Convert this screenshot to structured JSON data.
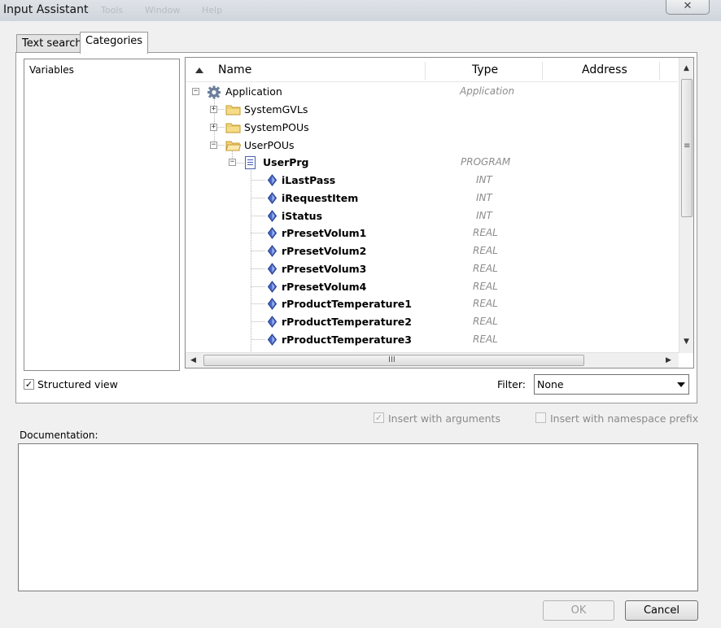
{
  "window": {
    "title": "Input Assistant",
    "background_menu": [
      "Tools",
      "Window",
      "Help"
    ]
  },
  "tabs": [
    {
      "label": "Text search",
      "active": false
    },
    {
      "label": "Categories",
      "active": true
    }
  ],
  "categories": [
    "Variables"
  ],
  "table": {
    "columns": [
      "Name",
      "Type",
      "Address"
    ],
    "rows": [
      {
        "name": "Application",
        "type": "Application",
        "bold": false,
        "expander": "minus",
        "icon": "gear-icon"
      },
      {
        "name": "SystemGVLs",
        "type": "",
        "bold": false,
        "expander": "plus",
        "icon": "folder-icon"
      },
      {
        "name": "SystemPOUs",
        "type": "",
        "bold": false,
        "expander": "plus",
        "icon": "folder-icon"
      },
      {
        "name": "UserPOUs",
        "type": "",
        "bold": false,
        "expander": "minus",
        "icon": "folder-open-icon"
      },
      {
        "name": "UserPrg",
        "type": "PROGRAM",
        "bold": true,
        "expander": "minus",
        "icon": "program-icon"
      },
      {
        "name": "iLastPass",
        "type": "INT",
        "bold": true,
        "icon": "variable-icon"
      },
      {
        "name": "iRequestItem",
        "type": "INT",
        "bold": true,
        "icon": "variable-icon"
      },
      {
        "name": "iStatus",
        "type": "INT",
        "bold": true,
        "icon": "variable-icon"
      },
      {
        "name": "rPresetVolum1",
        "type": "REAL",
        "bold": true,
        "icon": "variable-icon"
      },
      {
        "name": "rPresetVolum2",
        "type": "REAL",
        "bold": true,
        "icon": "variable-icon"
      },
      {
        "name": "rPresetVolum3",
        "type": "REAL",
        "bold": true,
        "icon": "variable-icon"
      },
      {
        "name": "rPresetVolum4",
        "type": "REAL",
        "bold": true,
        "icon": "variable-icon"
      },
      {
        "name": "rProductTemperature1",
        "type": "REAL",
        "bold": true,
        "icon": "variable-icon"
      },
      {
        "name": "rProductTemperature2",
        "type": "REAL",
        "bold": true,
        "icon": "variable-icon"
      },
      {
        "name": "rProductTemperature3",
        "type": "REAL",
        "bold": true,
        "icon": "variable-icon"
      }
    ]
  },
  "options": {
    "structured_view": {
      "label": "Structured view",
      "checked": true
    },
    "filter": {
      "label": "Filter:",
      "value": "None"
    },
    "insert_with_arguments": {
      "label": "Insert with arguments",
      "checked": true,
      "enabled": false
    },
    "insert_with_namespace_prefix": {
      "label": "Insert with namespace prefix",
      "checked": false,
      "enabled": false
    }
  },
  "documentation": {
    "label": "Documentation:",
    "text": ""
  },
  "buttons": {
    "ok": "OK",
    "cancel": "Cancel"
  },
  "icons": {
    "close": "✕",
    "grip_h": "III",
    "grip_v": "≡"
  }
}
